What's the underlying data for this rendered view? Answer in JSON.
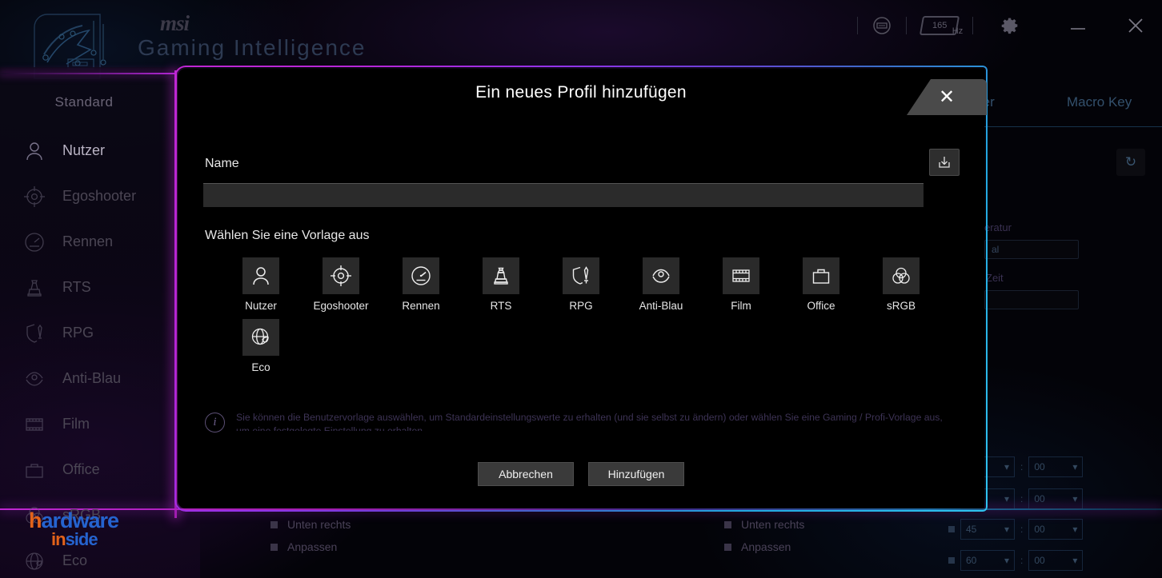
{
  "app": {
    "brand": "msi",
    "product": "Gaming Intelligence",
    "refresh_rate": "165",
    "refresh_unit": "Hz"
  },
  "titlebar": {
    "monitor_icon": "monitor-icon",
    "gear_icon": "gear-icon",
    "minimize_icon": "minimize-icon",
    "close_icon": "close-icon"
  },
  "background": {
    "profile_tab": "Standard",
    "sidebar": [
      {
        "label": "Nutzer",
        "icon": "person-icon",
        "active": true
      },
      {
        "label": "Egoshooter",
        "icon": "crosshair-icon",
        "active": false
      },
      {
        "label": "Rennen",
        "icon": "speedometer-icon",
        "active": false
      },
      {
        "label": "RTS",
        "icon": "chess-pawn-icon",
        "active": false
      },
      {
        "label": "RPG",
        "icon": "shield-sword-icon",
        "active": false
      },
      {
        "label": "Anti-Blau",
        "icon": "eye-icon",
        "active": false
      },
      {
        "label": "Film",
        "icon": "film-strip-icon",
        "active": false
      },
      {
        "label": "Office",
        "icon": "briefcase-icon",
        "active": false
      },
      {
        "label": "sRGB",
        "icon": "venn-circles-icon",
        "active": false
      },
      {
        "label": "Eco",
        "icon": "globe-leaf-icon",
        "active": false
      }
    ],
    "tabs": [
      "nster",
      "Macro Key"
    ],
    "reset_icon": "reset-icon",
    "labels": {
      "temperature": "eratur",
      "temperature_value": "al",
      "time": "Zeit"
    },
    "rows": [
      "Unten rechts",
      "Anpassen"
    ],
    "time_values": [
      {
        "minutes": "",
        "seconds": "00"
      },
      {
        "minutes": "",
        "seconds": "00"
      },
      {
        "minutes": "45",
        "seconds": "00"
      },
      {
        "minutes": "60",
        "seconds": "00"
      }
    ],
    "watermark": {
      "line1_a": "h",
      "line1_b": "ardware",
      "line2_a": "in",
      "line2_b": "side"
    }
  },
  "dialog": {
    "title": "Ein neues Profil hinzufügen",
    "close_label": "✕",
    "name_label": "Name",
    "name_value": "",
    "name_placeholder": "",
    "import_icon": "import-download-icon",
    "template_label": "Wählen Sie eine Vorlage aus",
    "templates": [
      {
        "label": "Nutzer",
        "icon": "person-icon"
      },
      {
        "label": "Egoshooter",
        "icon": "crosshair-icon"
      },
      {
        "label": "Rennen",
        "icon": "speedometer-icon"
      },
      {
        "label": "RTS",
        "icon": "chess-pawn-icon"
      },
      {
        "label": "RPG",
        "icon": "shield-sword-icon"
      },
      {
        "label": "Anti-Blau",
        "icon": "eye-icon"
      },
      {
        "label": "Film",
        "icon": "film-strip-icon"
      },
      {
        "label": "Office",
        "icon": "briefcase-icon"
      },
      {
        "label": "sRGB",
        "icon": "venn-circles-icon"
      },
      {
        "label": "Eco",
        "icon": "globe-leaf-icon"
      }
    ],
    "info_icon": "info-icon",
    "info_text": "Sie können die Benutzervorlage auswählen, um Standardeinstellungswerte zu erhalten (und sie selbst zu ändern) oder wählen Sie eine Gaming / Profi-Vorlage aus, um eine festgelegte Einstellung zu erhalten",
    "cancel_label": "Abbrechen",
    "add_label": "Hinzufügen"
  },
  "colors": {
    "accent_magenta": "#c026d3",
    "accent_cyan": "#2fc4ef",
    "dialog_bg": "#000000",
    "input_bg": "#2b2b2b",
    "button_bg": "#3a3a3a"
  }
}
